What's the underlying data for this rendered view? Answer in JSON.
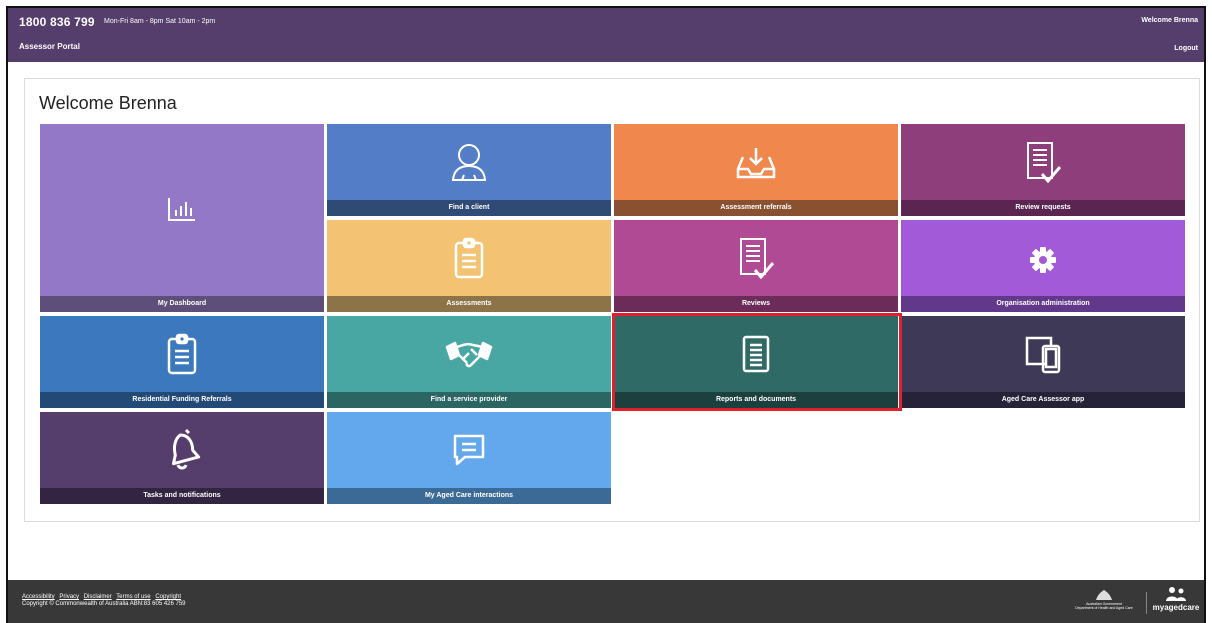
{
  "header": {
    "phone": "1800 836 799",
    "hours": "Mon-Fri 8am - 8pm Sat 10am - 2pm",
    "welcome": "Welcome Brenna",
    "portal": "Assessor Portal",
    "logout": "Logout"
  },
  "main": {
    "title": "Welcome Brenna"
  },
  "tiles": [
    {
      "label": "My Dashboard",
      "icon": "dashboard-chart-icon",
      "bg": "#9378c8",
      "bar": "#5d4f79"
    },
    {
      "label": "Find a client",
      "icon": "person-icon",
      "bg": "#547dc8",
      "bar": "#2f4a75"
    },
    {
      "label": "Assessment referrals",
      "icon": "inbox-download-icon",
      "bg": "#f0884e",
      "bar": "#8a5130"
    },
    {
      "label": "Review requests",
      "icon": "document-check-icon",
      "bg": "#8e3e7b",
      "bar": "#5a2550"
    },
    {
      "label": "Assessments",
      "icon": "clipboard-icon",
      "bg": "#f4c273",
      "bar": "#8d7448"
    },
    {
      "label": "Reviews",
      "icon": "document-check-icon",
      "bg": "#b04a95",
      "bar": "#6b2c5a"
    },
    {
      "label": "Organisation administration",
      "icon": "gear-icon",
      "bg": "#a35ad9",
      "bar": "#62388a"
    },
    {
      "label": "Residential Funding Referrals",
      "icon": "clipboard-icon",
      "bg": "#3c78bd",
      "bar": "#234a77"
    },
    {
      "label": "Find a service provider",
      "icon": "handshake-icon",
      "bg": "#48a7a3",
      "bar": "#2b6663"
    },
    {
      "label": "Reports and documents",
      "icon": "document-lines-icon",
      "bg": "#2f6a66",
      "bar": "#1c403e"
    },
    {
      "label": "Aged Care Assessor app",
      "icon": "devices-icon",
      "bg": "#3e3957",
      "bar": "#262338"
    },
    {
      "label": "Tasks and notifications",
      "icon": "bell-icon",
      "bg": "#553d6c",
      "bar": "#332542"
    },
    {
      "label": "My Aged Care interactions",
      "icon": "chat-icon",
      "bg": "#63a8ec",
      "bar": "#3b6a97"
    }
  ],
  "footer": {
    "links": [
      "Accessibility",
      "Privacy",
      "Disclaimer",
      "Terms of use",
      "Copyright"
    ],
    "copyright": "Copyright © Commonwealth of Australia ABN:83 605 426 759",
    "gov_line1": "Australian Government",
    "gov_line2": "Department of Health and Aged Care",
    "myagedcare": "myagedcare"
  }
}
